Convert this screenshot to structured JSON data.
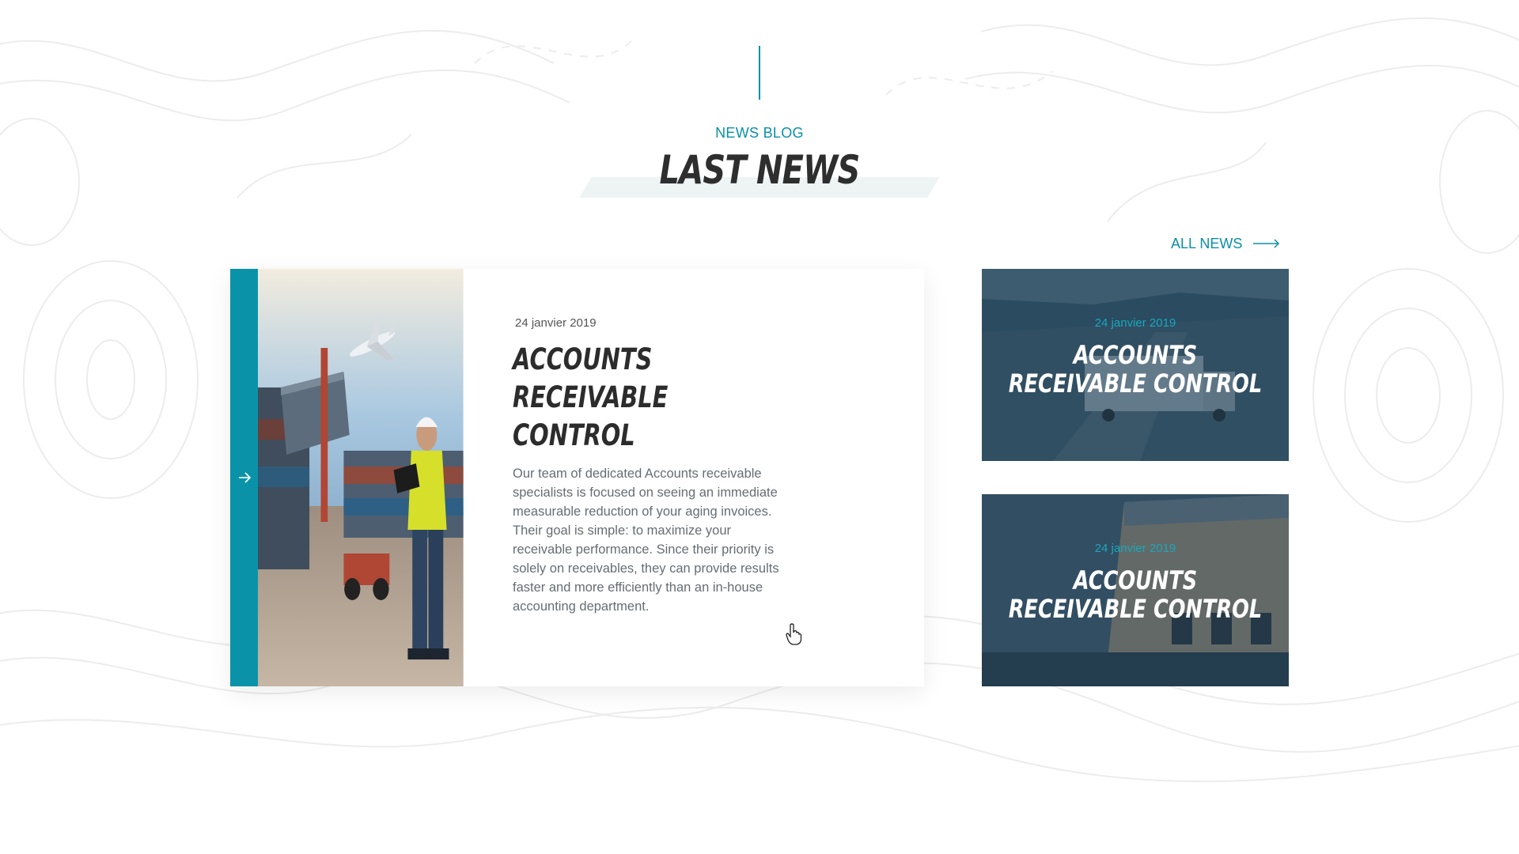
{
  "header": {
    "eyebrow": "NEWS BLOG",
    "title": "LAST NEWS"
  },
  "all_news": {
    "label": "ALL NEWS",
    "icon": "arrow-right-icon"
  },
  "main_article": {
    "date": "24 janvier 2019",
    "title": "ACCOUNTS RECEIVABLE CONTROL",
    "text": "Our team of dedicated Accounts receivable specialists is focused on seeing an immediate measurable reduction of your aging invoices. Their goal is simple: to maximize your receivable performance. Since their priority is solely on receivables, they can provide results faster and more efficiently than an in-house accounting department.",
    "image": "worker-containers-airplane",
    "strip_icon": "arrow-right-icon"
  },
  "side_articles": [
    {
      "date": "24 janvier 2019",
      "title": "ACCOUNTS RECEIVABLE CONTROL",
      "image": "truck-highway"
    },
    {
      "date": "24 janvier 2019",
      "title": "ACCOUNTS RECEIVABLE CONTROL",
      "image": "warehouse-docks"
    }
  ],
  "colors": {
    "accent": "#0a93a8",
    "title": "#2e2e2e",
    "body_text": "#666d73",
    "overlay": "#1f3f55"
  }
}
